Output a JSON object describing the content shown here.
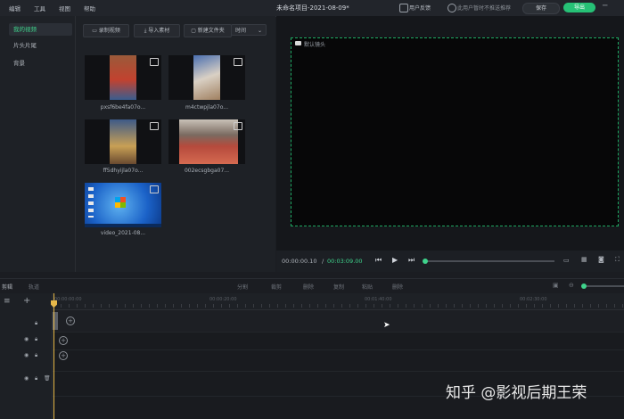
{
  "menu": [
    "编辑",
    "工具",
    "视图",
    "帮助"
  ],
  "title": "未命名项目-2021-08-09*",
  "topbar": {
    "feedback": "用户反馈",
    "notice": "此用户暂时不推送推荐",
    "save": "保存",
    "export": "导出"
  },
  "left_nav": {
    "items": [
      "我的视频",
      "片头片尾",
      "背景"
    ],
    "active_index": 0
  },
  "media_toolbar": {
    "record": "录制视频",
    "import": "导入素材",
    "new_folder": "新建文件夹",
    "sort": "时间"
  },
  "media_items": [
    {
      "name": "pxsf6be4fa07o..."
    },
    {
      "name": "m4ctwpjla07o..."
    },
    {
      "name": "ff5dhyijla07o..."
    },
    {
      "name": "002ecsgbga07..."
    },
    {
      "name": "video_2021-08..."
    }
  ],
  "preview": {
    "camera_label": "默认镜头",
    "current_time": "00:00:00.10",
    "separator": "/",
    "total_time": "00:03:09.00"
  },
  "timeline": {
    "left_labels": [
      "剪辑",
      "轨道"
    ],
    "tools": [
      "分割",
      "裁剪",
      "删除",
      "复制",
      "粘贴",
      "删除"
    ],
    "ruler_ticks": [
      "00:00:00:00",
      "00:00:20:00",
      "00:01:40:00",
      "00:02:30:00"
    ]
  },
  "watermark": "知乎 @影视后期王荣",
  "colors": {
    "accent": "#3fd38c",
    "selection_border": "#1ea861",
    "background": "#1b1d22"
  }
}
